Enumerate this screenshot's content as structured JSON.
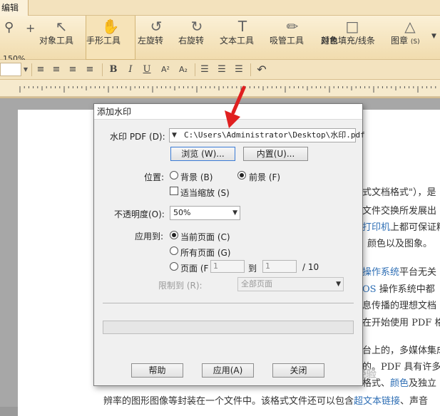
{
  "tabs": {
    "edit": "编辑"
  },
  "ribbon": {
    "zoom_value": "150%",
    "items": [
      {
        "label": "对象工具",
        "icon": "pointer-icon"
      },
      {
        "label": "手形工具",
        "icon": "hand-icon"
      },
      {
        "label": "左旋转",
        "icon": "rotate-left-icon"
      },
      {
        "label": "右旋转",
        "icon": "rotate-right-icon"
      },
      {
        "label": "文本工具",
        "icon": "text-tool-icon"
      },
      {
        "label": "吸管工具",
        "icon": "eyedropper-icon"
      },
      {
        "label": "对象填充/线条",
        "label2": "颜色",
        "icon": "fill-square-icon"
      },
      {
        "label": "图章",
        "suffix": "(S)",
        "icon": "stamp-icon"
      }
    ]
  },
  "format_bar": {
    "bold": "B",
    "italic": "I",
    "underline": "U",
    "superscript": "A²",
    "subscript": "A₂"
  },
  "document": {
    "lines": [
      {
        "text": "式文档格式\"），是"
      },
      {
        "text": "文件交换所发展出"
      },
      {
        "link": "打印机",
        "text": "上都可保证精"
      },
      {
        "text": "颜色以及图象。"
      },
      {
        "link": "操作系统",
        "text": "平台无关"
      },
      {
        "link": "OS",
        "text": " 操作系统中都"
      },
      {
        "text": "息传播的理想文档"
      },
      {
        "text": "在开始使用 PDF 格"
      },
      {
        "text": "台上的，多媒体集成"
      },
      {
        "text": "的。PDF 具有许多"
      },
      {
        "text": "格式、",
        "link2": "颜色",
        "text2": "及独立"
      },
      {
        "text": "辨率的图形图像等封装在一个文件中。该格式文件还可以包含",
        "link": "超文本链接",
        "text2": "、声音"
      }
    ]
  },
  "dialog": {
    "title": "添加水印",
    "watermark_pdf_label": "水印 PDF (D):",
    "watermark_pdf_path": "C:\\Users\\Administrator\\Desktop\\水印.pdf",
    "browse_button": "浏览 (W)...",
    "builtin_button": "内置(U)...",
    "position_label": "位置:",
    "background_option": "背景 (B)",
    "foreground_option": "前景 (F)",
    "position_selected": "foreground",
    "fit_scale_label": "适当缩放 (S)",
    "fit_scale_checked": false,
    "opacity_label": "不透明度(O):",
    "opacity_value": "50%",
    "apply_to_label": "应用到:",
    "current_page_option": "当前页面 (C)",
    "all_pages_option": "所有页面 (G)",
    "pages_option": "页面 (F",
    "page_from": "1",
    "page_to_label": "到",
    "page_to": "1",
    "page_total": "/ 10",
    "apply_selected": "current",
    "limit_label": "限制到 (R):",
    "limit_value": "全部页面",
    "help_button": "帮助",
    "apply_button": "应用(A)",
    "close_button": "关闭"
  },
  "watermark_text": "Bai 经验"
}
